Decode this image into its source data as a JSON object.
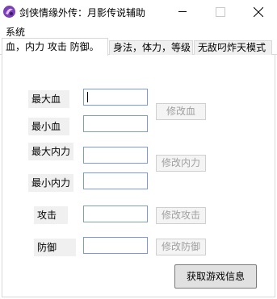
{
  "window": {
    "title": "剑侠情缘外传：月影传说辅助",
    "icon": "purple-orb-app-icon"
  },
  "menu": {
    "items": [
      "系统"
    ]
  },
  "tabs": [
    {
      "label": "血，内力 攻击 防御。",
      "active": true
    },
    {
      "label": "身法，体力，等级",
      "active": false
    },
    {
      "label": "无敌叼炸天模式",
      "active": false
    }
  ],
  "form": {
    "max_hp_label": "最大血",
    "min_hp_label": "最小血",
    "max_mp_label": "最大内力",
    "min_mp_label": "最小内力",
    "attack_label": "攻击",
    "defense_label": "防御",
    "max_hp_value": "",
    "min_hp_value": "",
    "max_mp_value": "",
    "min_mp_value": "",
    "attack_value": "",
    "defense_value": ""
  },
  "buttons": {
    "modify_hp": "修改血",
    "modify_mp": "修改内力",
    "modify_attack": "修改攻击",
    "modify_defense": "修改防御",
    "get_game_info": "获取游戏信息"
  }
}
